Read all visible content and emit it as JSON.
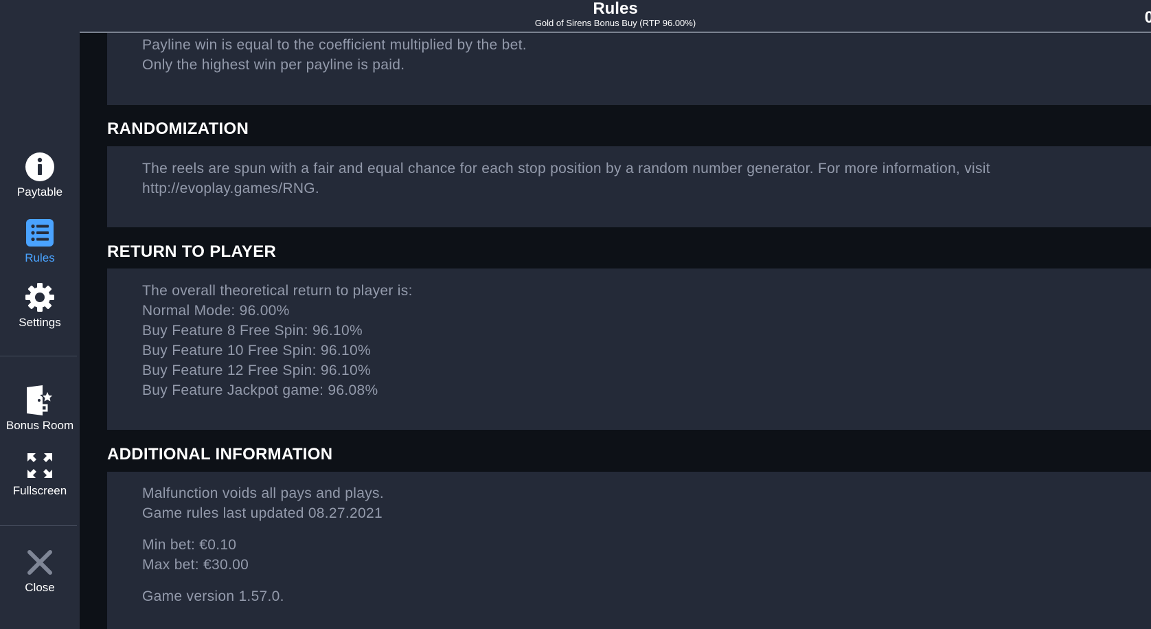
{
  "sidebar": {
    "items": [
      {
        "label": "Paytable",
        "icon": "info-icon",
        "active": false
      },
      {
        "label": "Rules",
        "icon": "list-icon",
        "active": true
      },
      {
        "label": "Settings",
        "icon": "gear-icon",
        "active": false
      },
      {
        "label": "Bonus Room",
        "icon": "bonus-room-icon",
        "active": false
      },
      {
        "label": "Fullscreen",
        "icon": "fullscreen-icon",
        "active": false
      },
      {
        "label": "Close",
        "icon": "close-icon",
        "active": false
      }
    ]
  },
  "header": {
    "title": "Rules",
    "subtitle": "Gold of Sirens Bonus Buy (RTP 96.00%)",
    "balance_fragment": "0"
  },
  "sections": {
    "paylines": {
      "lines": [
        "Payline win is equal to the coefficient multiplied by the bet.",
        "Only the highest win per payline is paid."
      ]
    },
    "randomization": {
      "title": "RANDOMIZATION",
      "lines": [
        "The reels are spun with a fair and equal chance for each stop position by a random number generator. For more information, visit",
        "http://evoplay.games/RNG."
      ]
    },
    "rtp": {
      "title": "RETURN TO PLAYER",
      "lines": [
        "The overall theoretical return to player is:",
        "Normal Mode: 96.00%",
        "Buy Feature 8 Free Spin: 96.10%",
        "Buy Feature 10 Free Spin: 96.10%",
        "Buy Feature 12 Free Spin: 96.10%",
        "Buy Feature Jackpot game: 96.08%"
      ]
    },
    "additional": {
      "title": "ADDITIONAL INFORMATION",
      "lines": [
        "Malfunction voids all pays and plays.",
        "Game rules last updated 08.27.2021",
        "Min bet: €0.10",
        "Max bet: €30.00",
        "Game version 1.57.0."
      ]
    }
  },
  "colors": {
    "sidebar_bg": "#262c3a",
    "panel_bg": "#242a38",
    "content_bg": "#0d1117",
    "accent": "#4aa3ff",
    "body_text": "#939aab"
  }
}
